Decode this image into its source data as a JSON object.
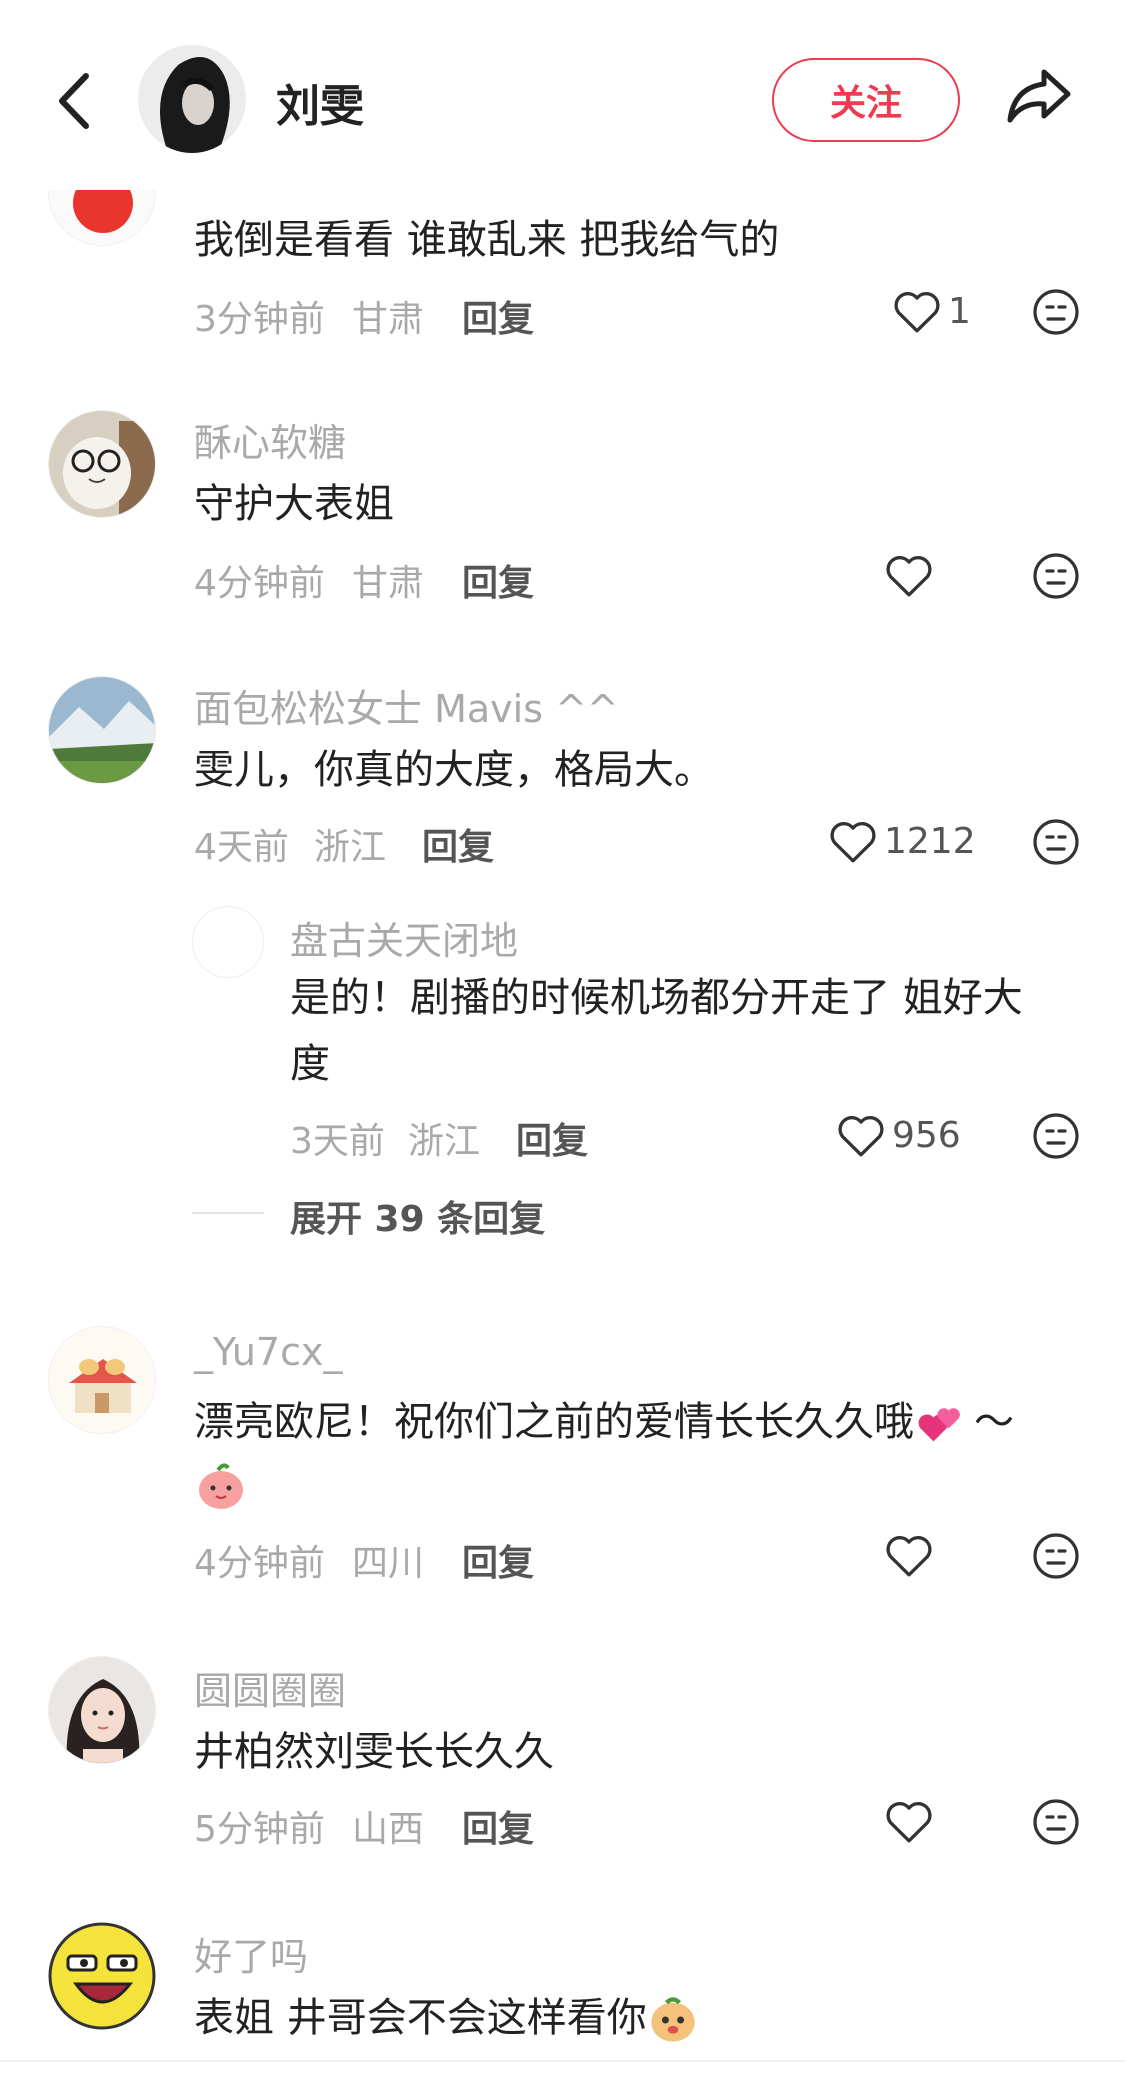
{
  "header": {
    "title": "刘雯",
    "follow_label": "关注",
    "back_icon": "chevron-left-icon",
    "share_icon": "share-arrow-icon"
  },
  "accent_color": "#ee3b50",
  "comments": [
    {
      "username": "",
      "text": "我倒是看看  谁敢乱来  把我给气的",
      "time": "3分钟前",
      "location": "甘肃",
      "reply_label": "回复",
      "likes": "1"
    },
    {
      "username": "酥心软糖",
      "text": "守护大表姐",
      "time": "4分钟前",
      "location": "甘肃",
      "reply_label": "回复",
      "likes": ""
    },
    {
      "username": "面包松松女士 Mavis ^^",
      "text": "雯儿，你真的大度，格局大。",
      "time": "4天前",
      "location": "浙江",
      "reply_label": "回复",
      "likes": "1212",
      "sub_reply": {
        "username": "盘古关天闭地",
        "text_line1": "是的！剧播的时候机场都分开走了 姐好大",
        "text_line2": "度",
        "time": "3天前",
        "location": "浙江",
        "reply_label": "回复",
        "likes": "956"
      },
      "expand_label": "展开 39 条回复"
    },
    {
      "username": "_Yu7cx_",
      "text": "漂亮欧尼！祝你们之前的爱情长长久久哦",
      "text_tail": "～",
      "time": "4分钟前",
      "location": "四川",
      "reply_label": "回复",
      "likes": ""
    },
    {
      "username": "圆圆圈圈",
      "text": "井柏然刘雯长长久久",
      "time": "5分钟前",
      "location": "山西",
      "reply_label": "回复",
      "likes": ""
    },
    {
      "username": "好了吗",
      "text": "表姐  井哥会不会这样看你",
      "time": "",
      "location": "",
      "reply_label": "",
      "likes": ""
    }
  ]
}
